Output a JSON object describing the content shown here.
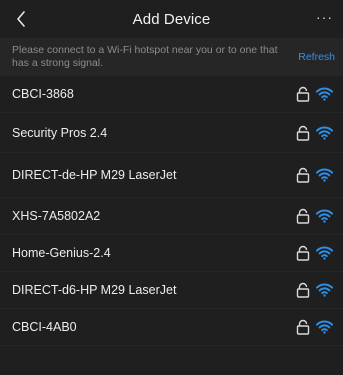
{
  "header": {
    "title": "Add Device",
    "more": "···"
  },
  "notice": {
    "text": "Please connect to a Wi-Fi hotspot near you or to one that has a strong signal.",
    "refresh_label": "Refresh"
  },
  "networks": [
    {
      "name": "CBCI-3868",
      "icon": "lock-icon",
      "signal_icon": "wifi-icon"
    },
    {
      "name": "Security Pros 2.4",
      "icon": "lock-icon",
      "signal_icon": "wifi-icon"
    },
    {
      "name": "DIRECT-de-HP M29 LaserJet",
      "icon": "lock-icon",
      "signal_icon": "wifi-icon"
    },
    {
      "name": "XHS-7A5802A2",
      "icon": "lock-icon",
      "signal_icon": "wifi-icon"
    },
    {
      "name": "Home-Genius-2.4",
      "icon": "lock-icon",
      "signal_icon": "wifi-icon"
    },
    {
      "name": "DIRECT-d6-HP M29 LaserJet",
      "icon": "lock-icon",
      "signal_icon": "wifi-icon"
    },
    {
      "name": "CBCI-4AB0",
      "icon": "lock-icon",
      "signal_icon": "wifi-icon"
    }
  ],
  "colors": {
    "background": "#1f1f1f",
    "accent": "#3b8fe0",
    "wifi": "#2f8fe6"
  }
}
